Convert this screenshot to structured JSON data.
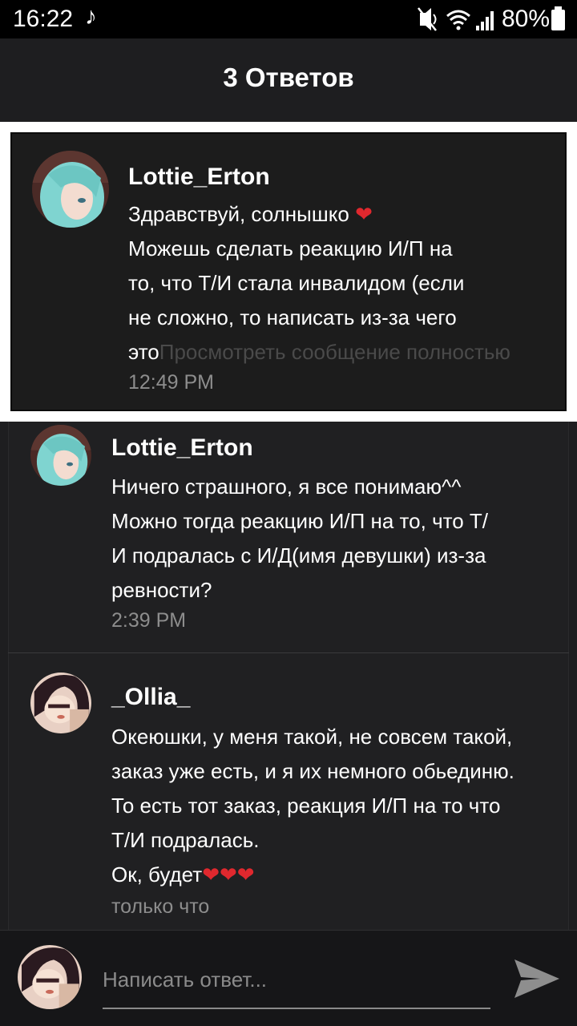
{
  "status_bar": {
    "time": "16:22",
    "battery": "80%"
  },
  "header": {
    "title": "3 Ответов"
  },
  "parent_comment": {
    "username": "Lottie_Erton",
    "lines": [
      "Здравствуй, солнышко",
      "Можешь сделать реакцию И/П на",
      "то, что Т/И стала инвалидом (если",
      "не сложно, то написать из-за чего",
      "это"
    ],
    "see_more": "Просмотреть сообщение полностью",
    "time": "12:49 PM"
  },
  "replies": [
    {
      "username": "Lottie_Erton",
      "lines": [
        "Ничего страшного, я все понимаю^^",
        "Можно тогда реакцию И/П на то, что Т/",
        "И подралась с И/Д(имя девушки) из-за",
        "ревности?"
      ],
      "time": "2:39 PM"
    },
    {
      "username": "_Ollia_",
      "lines": [
        "Океюшки, у меня такой, не совсем такой,",
        "заказ уже есть, и я их немного обьединю.",
        "То есть тот заказ, реакция И/П на то что",
        "Т/И подралась.",
        "Ок, будет"
      ],
      "time": "только что"
    }
  ],
  "input": {
    "placeholder": "Написать ответ..."
  },
  "colors": {
    "heart": "#e0282e",
    "background": "#1e1e20",
    "timestamp": "#8d8d8d"
  },
  "icons": [
    "music-note-icon",
    "mute-icon",
    "wifi-icon",
    "signal-icon",
    "battery-icon",
    "heart-icon",
    "send-icon"
  ]
}
